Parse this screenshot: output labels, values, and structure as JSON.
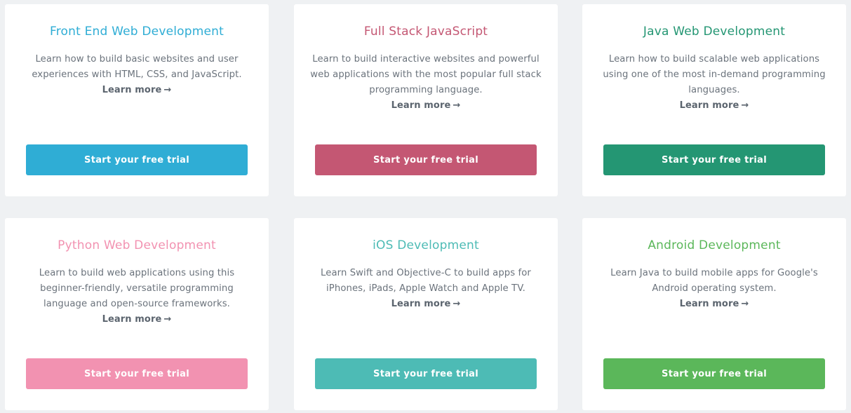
{
  "learn_more_label": "Learn more",
  "arrow_glyph": "→",
  "cta_label": "Start your free trial",
  "tracks": [
    {
      "title": "Front End Web Development",
      "description": "Learn how to build basic websites and user experiences with HTML, CSS, and JavaScript.",
      "color": "#2fadd5"
    },
    {
      "title": "Full Stack JavaScript",
      "description": "Learn to build interactive websites and powerful web applications with the most popular full stack programming language.",
      "color": "#c45773"
    },
    {
      "title": "Java Web Development",
      "description": "Learn how to build scalable web applications using one of the most in-demand programming languages.",
      "color": "#249673"
    },
    {
      "title": "Python Web Development",
      "description": "Learn to build web applications using this beginner-friendly, versatile programming language and open-source frameworks.",
      "color": "#f292b1"
    },
    {
      "title": "iOS Development",
      "description": "Learn Swift and Objective-C to build apps for iPhones, iPads, Apple Watch and Apple TV.",
      "color": "#4dbbb5"
    },
    {
      "title": "Android Development",
      "description": "Learn Java to build mobile apps for Google's Android operating system.",
      "color": "#5bb75a"
    }
  ]
}
